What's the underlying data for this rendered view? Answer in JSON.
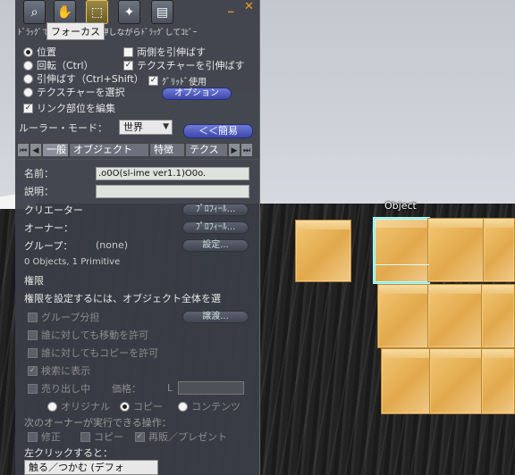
{
  "world": {
    "object_label": "Object"
  },
  "toolbar": {
    "tooltip": "フォーカス",
    "hint": "ﾄﾞﾗｯｸﾞで移動、Shiftを押しながらﾄﾞﾗｯｸﾞしてｺﾋﾟｰ",
    "icons": [
      "zoom-icon",
      "grab-hand-icon",
      "select-cursor-icon",
      "magic-wand-icon",
      "land-icon"
    ]
  },
  "modes": {
    "position": "位置",
    "rotate": "回転（Ctrl）",
    "stretch": "引伸ばす（Ctrl+Shift）",
    "select_texture": "テクスチャーを選択",
    "stretch_both_sides": "両側を引伸ばす",
    "stretch_textures": "テクスチャーを引伸ばす",
    "use_grid": "ｸﾞﾘｯﾄﾞ使用",
    "options_button": "オプション",
    "edit_linked": "リンク部位を編集"
  },
  "ruler": {
    "label": "ルーラー・モード：",
    "value": "世界",
    "less_button": "＜＜簡易"
  },
  "tabs": [
    "一般",
    "オブジェクト",
    "特徴",
    "テクス"
  ],
  "general": {
    "name_label": "名前：",
    "name_value": ".o0O(sl-ime ver1.1)O0o.",
    "description_label": "説明：",
    "description_value": "",
    "creator_label": "クリエーター",
    "owner_label": "オーナー：",
    "profile_button": "ﾌﾟﾛﾌｨｰﾙ...",
    "group_label": "グループ：",
    "group_value": "(none)",
    "group_settings_button": "設定...",
    "object_count": "0 Objects, 1 Primitive",
    "permissions_heading": "権限",
    "permissions_note": "権限を設定するには、オブジェクト全体を選",
    "share_with_group": "グループ分担",
    "deed_button": "譲渡...",
    "anyone_move": "誰に対しても移動を許可",
    "anyone_copy": "誰に対してもコピーを許可",
    "show_in_search": "検索に表示",
    "for_sale": "売り出し中",
    "price_label": "価格：",
    "price_currency": "L",
    "price_value": "",
    "sale_original": "オリジナル",
    "sale_copy": "コピー",
    "sale_contents": "コンテンツ",
    "next_owner_label": "次のオーナーが実行できる操作：",
    "next_modify": "修正",
    "next_copy": "コピー",
    "next_resell": "再販／プレゼント",
    "left_click_label": "左クリックすると：",
    "left_click_value": "触る／つかむ (デフォ"
  }
}
